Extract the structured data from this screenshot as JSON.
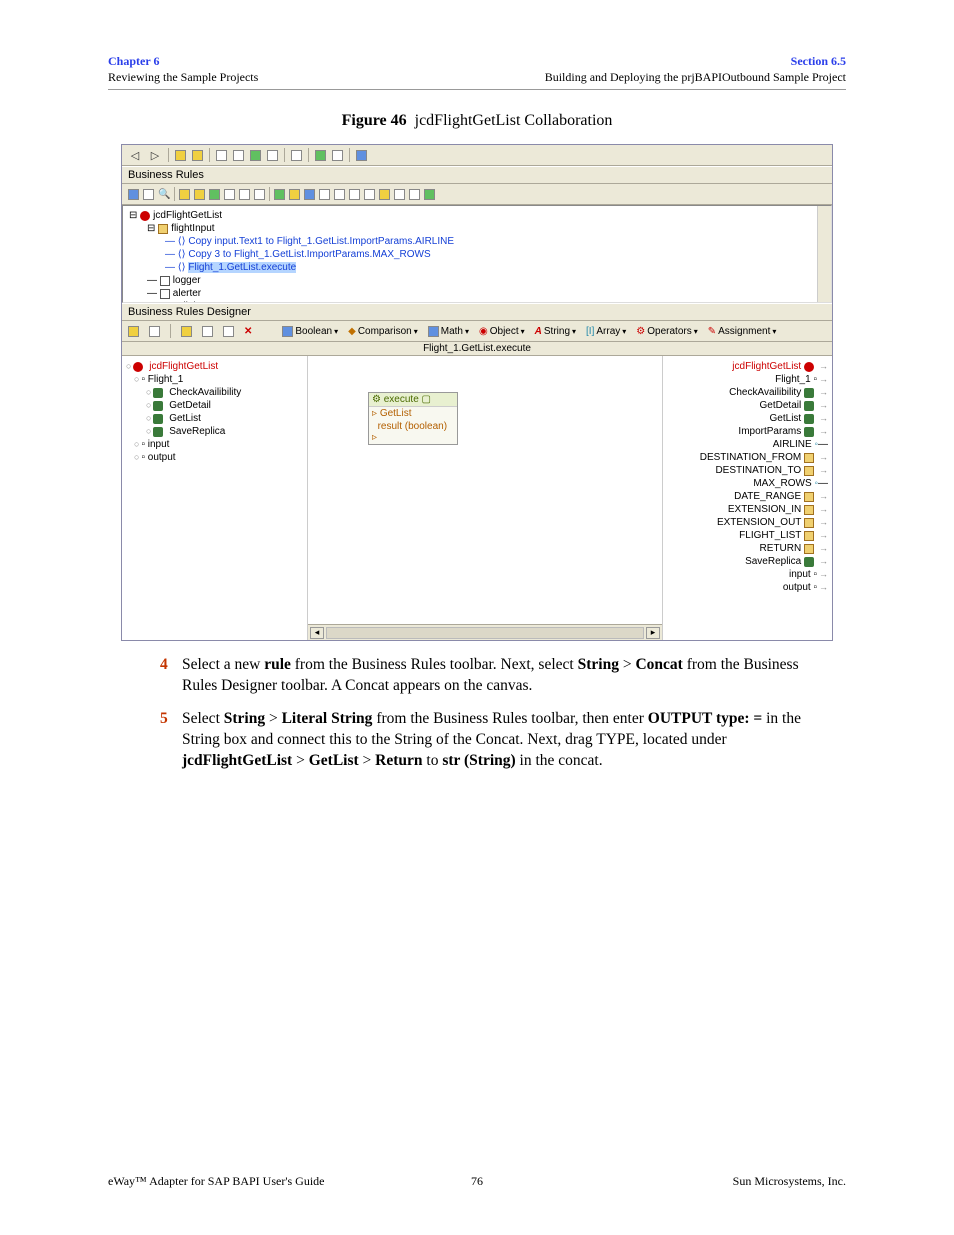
{
  "header": {
    "chapter": "Chapter 6",
    "left_sub": "Reviewing the Sample Projects",
    "section": "Section 6.5",
    "right_sub": "Building and Deploying the prjBAPIOutbound Sample Project"
  },
  "figure": {
    "label": "Figure 46",
    "title": "jcdFlightGetList Collaboration"
  },
  "screenshot": {
    "business_rules_label": "Business Rules",
    "designer_label": "Business Rules Designer",
    "tree": {
      "root": "jcdFlightGetList",
      "child1": "flightInput",
      "copy1": "Copy input.Text1 to Flight_1.GetList.ImportParams.AIRLINE",
      "copy2": "Copy 3 to Flight_1.GetList.ImportParams.MAX_ROWS",
      "exec": "Flight_1.GetList.execute",
      "logger": "logger",
      "alerter": "alerter",
      "collab": "collabContext"
    },
    "designer_toolbar": {
      "boolean": "Boolean",
      "comparison": "Comparison",
      "math": "Math",
      "object": "Object",
      "string": "String",
      "array": "Array",
      "operators": "Operators",
      "assignment": "Assignment"
    },
    "designer_title": "Flight_1.GetList.execute",
    "left_tree": {
      "root": "jcdFlightGetList",
      "flight": "Flight_1",
      "check": "CheckAvailibility",
      "getdetail": "GetDetail",
      "getlist": "GetList",
      "savereplica": "SaveReplica",
      "input": "input",
      "output": "output"
    },
    "node": {
      "title": "execute",
      "row1": "GetList",
      "row2": "result (boolean)"
    },
    "right_tree": {
      "root": "jcdFlightGetList",
      "flight": "Flight_1",
      "check": "CheckAvailibility",
      "getdetail": "GetDetail",
      "getlist": "GetList",
      "import": "ImportParams",
      "airline": "AIRLINE",
      "dest_from": "DESTINATION_FROM",
      "dest_to": "DESTINATION_TO",
      "max_rows": "MAX_ROWS",
      "date_range": "DATE_RANGE",
      "ext_in": "EXTENSION_IN",
      "ext_out": "EXTENSION_OUT",
      "flight_list": "FLIGHT_LIST",
      "return": "RETURN",
      "savereplica": "SaveReplica",
      "input": "input",
      "output": "output"
    }
  },
  "steps": {
    "s4_pre": "Select a new ",
    "s4_rule": "rule",
    "s4_mid1": " from the Business Rules toolbar. Next, select ",
    "s4_string": "String",
    "s4_gt": " > ",
    "s4_concat": "Concat",
    "s4_post": " from the Business Rules Designer toolbar. A Concat appears on the canvas.",
    "s5_pre": "Select ",
    "s5_string": "String",
    "s5_gt": " > ",
    "s5_lit": "Literal String",
    "s5_mid1": " from the Business Rules toolbar, then enter ",
    "s5_out": "OUTPUT type: =",
    "s5_mid2": " in the String box and connect this to the String of the Concat. Next, drag TYPE, located under ",
    "s5_jcd": "jcdFlightGetList",
    "s5_gl": "GetList",
    "s5_ret": "Return",
    "s5_to": " to ",
    "s5_str": "str (String)",
    "s5_post": " in the concat."
  },
  "footer": {
    "left": "eWay™ Adapter for SAP BAPI User's Guide",
    "mid": "76",
    "right": "Sun Microsystems, Inc."
  }
}
